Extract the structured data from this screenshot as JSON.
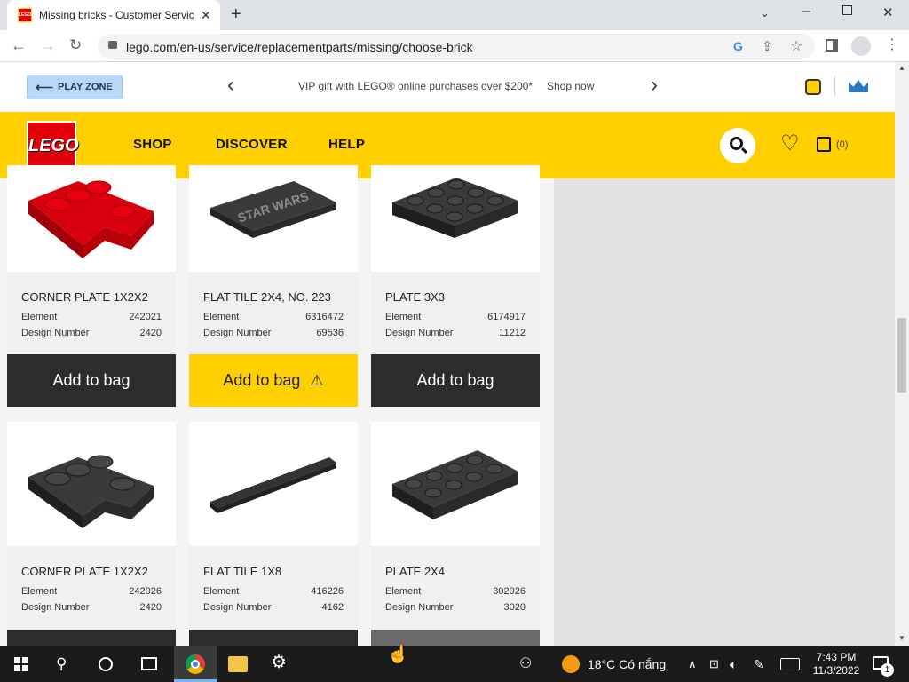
{
  "browser": {
    "tab_title": "Missing bricks - Customer Servic",
    "tab_favicon": "LEGO",
    "url": "lego.com/en-us/service/replacementparts/missing/choose-brick"
  },
  "site": {
    "play_zone": "PLAY ZONE",
    "promo": "VIP gift with LEGO® online purchases over $200*",
    "shop_now": "Shop now",
    "logo_text": "LEGO",
    "nav": [
      "SHOP",
      "DISCOVER",
      "HELP"
    ],
    "bag_count": "(0)"
  },
  "products": [
    {
      "name": "CORNER PLATE 1X2X2",
      "element_label": "Element",
      "element": "242021",
      "design_label": "Design Number",
      "design": "2420",
      "button": "Add to bag",
      "color": "#d9000d"
    },
    {
      "name": "FLAT TILE 2X4, NO. 223",
      "element_label": "Element",
      "element": "6316472",
      "design_label": "Design Number",
      "design": "69536",
      "button": "Add to bag",
      "color": "#2c2c2c"
    },
    {
      "name": "PLATE 3X3",
      "element_label": "Element",
      "element": "6174917",
      "design_label": "Design Number",
      "design": "11212",
      "button": "Add to bag",
      "color": "#2c2c2c"
    },
    {
      "name": "CORNER PLATE 1X2X2",
      "element_label": "Element",
      "element": "242026",
      "design_label": "Design Number",
      "design": "2420",
      "color": "#2c2c2c"
    },
    {
      "name": "FLAT TILE 1X8",
      "element_label": "Element",
      "element": "416226",
      "design_label": "Design Number",
      "design": "4162",
      "color": "#2c2c2c"
    },
    {
      "name": "PLATE 2X4",
      "element_label": "Element",
      "element": "302026",
      "design_label": "Design Number",
      "design": "3020",
      "color": "#2c2c2c"
    }
  ],
  "tile_print": "STAR WARS",
  "taskbar": {
    "weather": "18°C Có nắng",
    "time": "7:43 PM",
    "date": "11/3/2022",
    "notifications": "1"
  },
  "colors": {
    "lego_yellow": "#ffcf00",
    "lego_red": "#e3000b",
    "button_dark": "#2c2c2c"
  }
}
